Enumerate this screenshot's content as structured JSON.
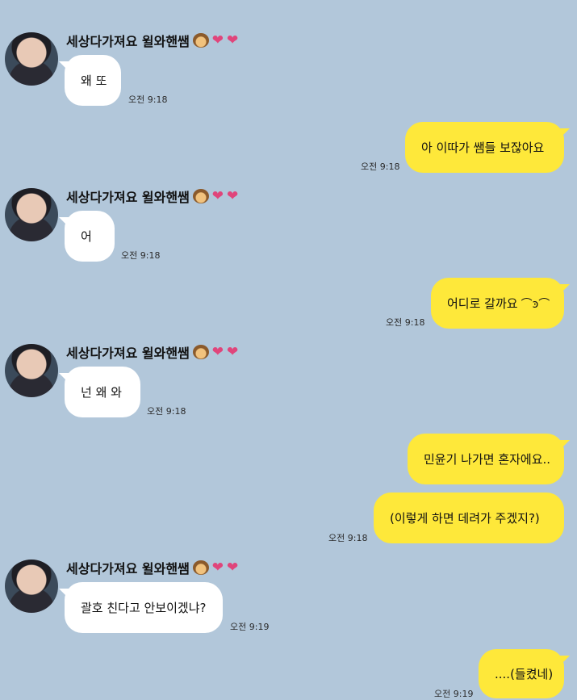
{
  "chat": {
    "sender_name": "세상다가져요 윌와핸쌤",
    "messages": [
      {
        "dir": "in",
        "text": "왜 또",
        "time": "오전 9:18"
      },
      {
        "dir": "out",
        "text": "아 이따가 쌤들 보잖아요",
        "time": "오전 9:18"
      },
      {
        "dir": "in",
        "text": "어",
        "time": "오전 9:18"
      },
      {
        "dir": "out",
        "text": "어디로 갈까요",
        "time": "오전 9:18"
      },
      {
        "dir": "in",
        "text": "넌 왜 와",
        "time": "오전 9:18"
      },
      {
        "dir": "out",
        "text": "민윤기 나가면 혼자에요..",
        "time": ""
      },
      {
        "dir": "out",
        "text": "(이렇게 하면 데려가 주겠지?)",
        "time": "오전 9:18"
      },
      {
        "dir": "in",
        "text": "괄호 친다고 안보이겠냐?",
        "time": "오전 9:19"
      },
      {
        "dir": "out",
        "text": "....(들켰네)",
        "time": "오전 9:19"
      }
    ]
  },
  "icons": {
    "monkey": "see-no-evil-monkey-icon",
    "heart": "heart-icon",
    "swirl": "swirl-doodle-icon"
  },
  "colors": {
    "background": "#b2c7da",
    "incoming_bubble": "#ffffff",
    "outgoing_bubble": "#fee83a",
    "heart": "#e0457b"
  }
}
